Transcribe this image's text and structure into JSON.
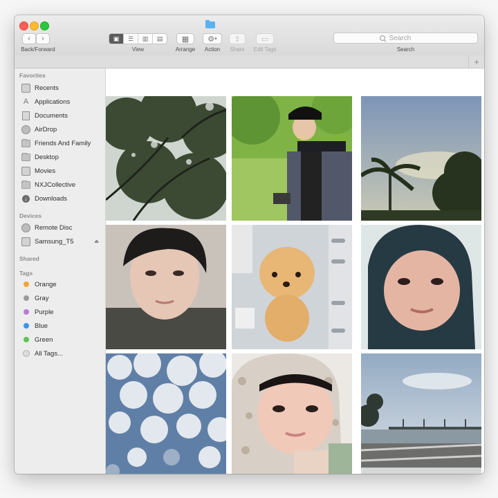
{
  "toolbar": {
    "back_label": "Back/Forward",
    "view_label": "View",
    "arrange_label": "Arrange",
    "action_label": "Action",
    "share_label": "Share",
    "edit_tags_label": "Edit Tags",
    "search_label": "Search",
    "search_placeholder": "Search",
    "back_icon": "chevron-left",
    "forward_icon": "chevron-right"
  },
  "tabbar": {
    "add_label": "+"
  },
  "sidebar": {
    "favorites_heading": "Favorites",
    "favorites": [
      {
        "label": "Recents",
        "icon": "clock-icon"
      },
      {
        "label": "Applications",
        "icon": "applications-icon"
      },
      {
        "label": "Documents",
        "icon": "document-icon"
      },
      {
        "label": "AirDrop",
        "icon": "airdrop-icon"
      },
      {
        "label": "Friends And Family",
        "icon": "folder-icon"
      },
      {
        "label": "Desktop",
        "icon": "folder-icon"
      },
      {
        "label": "Movies",
        "icon": "film-icon"
      },
      {
        "label": "NXJCollective",
        "icon": "folder-icon"
      },
      {
        "label": "Downloads",
        "icon": "download-icon"
      }
    ],
    "devices_heading": "Devices",
    "devices": [
      {
        "label": "Remote Disc",
        "icon": "disc-icon"
      },
      {
        "label": "Samsung_T5",
        "icon": "drive-icon",
        "eject": "⏏"
      }
    ],
    "shared_heading": "Shared",
    "tags_heading": "Tags",
    "tags": [
      {
        "label": "Orange",
        "color": "#f5a33b"
      },
      {
        "label": "Gray",
        "color": "#9a9a9a"
      },
      {
        "label": "Purple",
        "color": "#b77dd9"
      },
      {
        "label": "Blue",
        "color": "#3a96f2"
      },
      {
        "label": "Green",
        "color": "#5fc454"
      },
      {
        "label": "All Tags...",
        "color": "#dcdcdc"
      }
    ]
  },
  "photos": [
    {
      "name": "tree-canopy-photo"
    },
    {
      "name": "man-in-cap-photo"
    },
    {
      "name": "palm-tree-sky-photo"
    },
    {
      "name": "portrait-man-photo"
    },
    {
      "name": "plush-toy-photo"
    },
    {
      "name": "selfie-hijab-black-photo"
    },
    {
      "name": "cloudy-sky-photo"
    },
    {
      "name": "selfie-hijab-floral-photo"
    },
    {
      "name": "pier-landscape-photo"
    }
  ]
}
